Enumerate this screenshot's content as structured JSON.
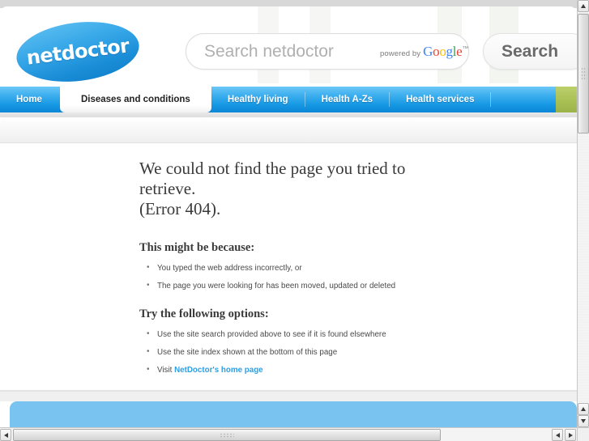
{
  "site": {
    "logo_text": "netdoctor"
  },
  "search": {
    "placeholder": "Search netdoctor",
    "value": "",
    "powered_by_label": "powered by",
    "google_letters": [
      "G",
      "o",
      "o",
      "g",
      "l",
      "e"
    ],
    "trademark": "™",
    "button_label": "Search"
  },
  "nav": {
    "items": [
      {
        "label": "Home",
        "active": false
      },
      {
        "label": "Diseases and conditions",
        "active": true
      },
      {
        "label": "Healthy living",
        "active": false
      },
      {
        "label": "Health A-Zs",
        "active": false
      },
      {
        "label": "Health services",
        "active": false
      }
    ]
  },
  "error": {
    "title_line1": "We could not find the page you tried to retrieve.",
    "title_line2": "(Error 404).",
    "reasons_heading": "This might be because:",
    "reasons": [
      "You typed the web address incorrectly, or",
      "The page you were looking for has been moved, updated or deleted"
    ],
    "options_heading": "Try the following options:",
    "options": [
      {
        "text": "Use the site search provided above to see if it is found elsewhere",
        "link": null
      },
      {
        "text": "Use the site index shown at the bottom of this page",
        "link": null
      },
      {
        "text": "Visit ",
        "link": "NetDoctor's home page"
      }
    ]
  },
  "colors": {
    "nav_blue_top": "#6ec7f7",
    "nav_blue_bottom": "#0c86d5",
    "nav_accent_green": "#a9c055",
    "footer_blue": "#78c3f0",
    "link_blue": "#2e9fe3"
  }
}
